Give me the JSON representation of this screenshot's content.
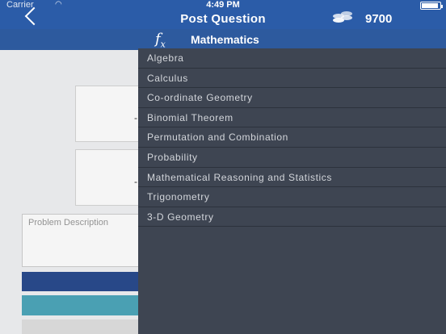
{
  "status_bar": {
    "carrier": "Carrier",
    "wifi_icon": "wifi-icon",
    "time": "4:49 PM",
    "battery_icon": "battery-icon"
  },
  "nav": {
    "back_icon": "back-chevron-icon",
    "title": "Post Question",
    "coins_icon": "coins-icon",
    "coin_count": "9700"
  },
  "subject": {
    "icon": "function-icon",
    "icon_text": "f",
    "icon_sub": "x",
    "title": "Mathematics"
  },
  "form": {
    "tick_mark": "-",
    "description_placeholder": "Problem Description"
  },
  "menu": {
    "items": [
      {
        "label": "Algebra"
      },
      {
        "label": "Calculus"
      },
      {
        "label": "Co-ordinate Geometry"
      },
      {
        "label": "Binomial Theorem"
      },
      {
        "label": "Permutation and Combination"
      },
      {
        "label": "Probability"
      },
      {
        "label": "Mathematical Reasoning and Statistics"
      },
      {
        "label": "Trigonometry"
      },
      {
        "label": "3-D Geometry"
      }
    ]
  },
  "colors": {
    "nav_bg": "#2b5ca8",
    "subject_bar_bg": "#2d5a9e",
    "menu_bg": "#3e4552",
    "menu_text": "#d3d6db",
    "primary_button": "#2a4b8e",
    "secondary_button": "#4ea7bb"
  }
}
